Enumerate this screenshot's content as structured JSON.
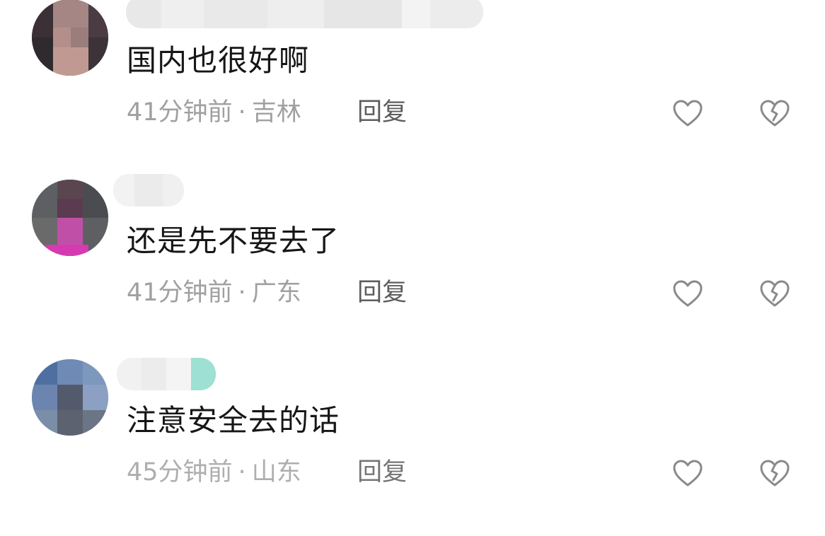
{
  "colors": {
    "text_primary": "#161616",
    "text_meta": "#a0a0a0",
    "text_reply": "#5d5d5d",
    "icon_stroke": "#8a8a8a"
  },
  "comments": [
    {
      "text": "国内也很好啊",
      "time": "41分钟前",
      "separator": "·",
      "location": "吉林",
      "reply_label": "回复",
      "like_icon": "heart-outline-icon",
      "dislike_icon": "broken-heart-icon"
    },
    {
      "text": "还是先不要去了",
      "time": "41分钟前",
      "separator": "·",
      "location": "广东",
      "reply_label": "回复",
      "like_icon": "heart-outline-icon",
      "dislike_icon": "broken-heart-icon"
    },
    {
      "text": "注意安全去的话",
      "time": "45分钟前",
      "separator": "·",
      "location": "山东",
      "reply_label": "回复",
      "like_icon": "heart-outline-icon",
      "dislike_icon": "broken-heart-icon"
    }
  ]
}
